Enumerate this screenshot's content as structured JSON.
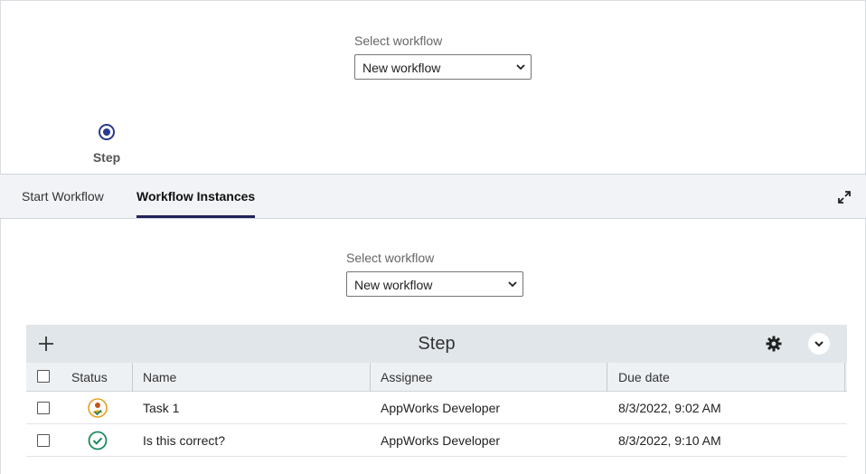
{
  "top": {
    "select_label": "Select workflow",
    "select_value": "New workflow",
    "step_label": "Step"
  },
  "tabs": [
    {
      "label": "Start Workflow",
      "active": false
    },
    {
      "label": "Workflow Instances",
      "active": true
    }
  ],
  "instances": {
    "select_label": "Select workflow",
    "select_value": "New workflow",
    "grid": {
      "title": "Step",
      "columns": [
        "Status",
        "Name",
        "Assignee",
        "Due date"
      ],
      "rows": [
        {
          "status": "assigned-user-icon",
          "name": "Task 1",
          "assignee": "AppWorks Developer",
          "due": "8/3/2022, 9:02 AM"
        },
        {
          "status": "check-circle-icon",
          "name": "Is this correct?",
          "assignee": "AppWorks Developer",
          "due": "8/3/2022, 9:10 AM"
        }
      ]
    }
  },
  "colors": {
    "accent": "#22225a",
    "step_node": "#2b3a8c",
    "status_orange": "#e8a020",
    "status_green": "#1a8a5a",
    "header_bg": "#e1e6ea"
  }
}
